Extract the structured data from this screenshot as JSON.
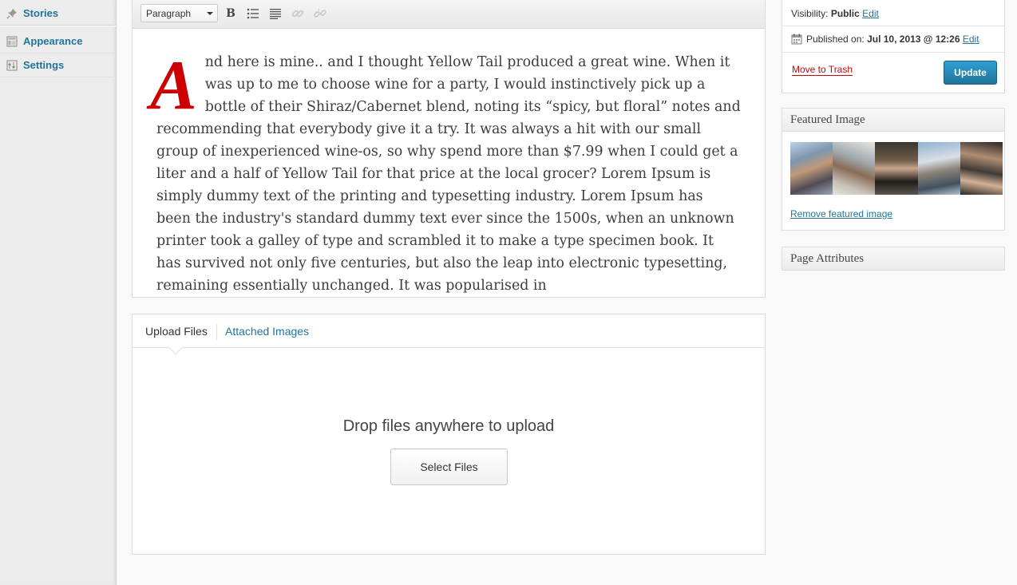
{
  "menu": {
    "items": [
      {
        "label": "Stories",
        "icon": "pin-icon"
      },
      {
        "label": "Appearance",
        "icon": "appearance-icon"
      },
      {
        "label": "Settings",
        "icon": "settings-icon"
      }
    ]
  },
  "editor": {
    "format_value": "Paragraph",
    "toolbar_icons": [
      "bold-icon",
      "bullet-list-icon",
      "align-justify-icon",
      "link-icon",
      "unlink-icon"
    ],
    "drop_cap": "A",
    "body_text": "nd here is mine.. and I thought Yellow Tail produced a great wine. When it was up to me to choose wine for a party, I would instinctively pick up a bottle of their Shiraz/Cabernet blend, noting its “spicy, but floral” notes and recommending that everybody give it a try. It was always a hit with our small group of inexperienced wine-os, so why spend more than $7.99 when I could get a liter and a half of Yellow Tail for that price at the local grocer? Lorem Ipsum is simply dummy text of the printing and typesetting industry. Lorem Ipsum has been the industry's standard dummy text ever since the 1500s, when an unknown printer took a galley of type and scrambled it to make a type specimen book. It has survived not only five centuries, but also the leap into electronic typesetting, remaining essentially unchanged. It was popularised in",
    "drop_cap_color": "#cc0000"
  },
  "uploader": {
    "tabs": [
      "Upload Files",
      "Attached Images"
    ],
    "drop_text": "Drop files anywhere to upload",
    "select_button": "Select Files"
  },
  "publish": {
    "visibility_label": "Visibility:",
    "visibility_value": "Public",
    "visibility_edit": "Edit",
    "published_label": "Published on:",
    "published_value": "Jul 10, 2013 @ 12:26",
    "published_edit": "Edit",
    "trash_label": "Move to Trash",
    "update_label": "Update",
    "update_color": "#21759b",
    "trash_color": "#bc0b0b"
  },
  "featured_image": {
    "title": "Featured Image",
    "remove_link": "Remove featured image"
  },
  "page_attributes": {
    "title": "Page Attributes"
  }
}
